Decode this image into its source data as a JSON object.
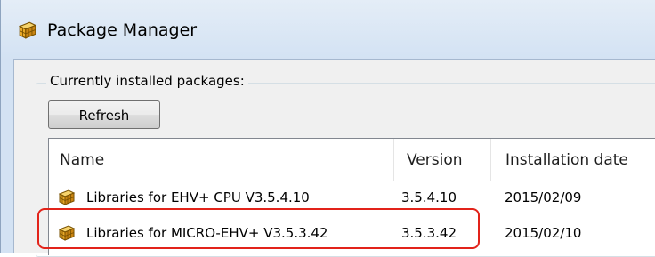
{
  "window": {
    "title": "Package Manager",
    "icon": "package-icon"
  },
  "group": {
    "label": "Currently installed packages:"
  },
  "toolbar": {
    "refresh_label": "Refresh"
  },
  "table": {
    "columns": [
      "Name",
      "Version",
      "Installation date"
    ],
    "rows": [
      {
        "name": "Libraries for EHV+ CPU V3.5.4.10",
        "version": "3.5.4.10",
        "date": "2015/02/09",
        "icon": "package-icon"
      },
      {
        "name": "Libraries for MICRO-EHV+ V3.5.3.42",
        "version": "3.5.3.42",
        "date": "2015/02/10",
        "icon": "package-icon"
      }
    ]
  },
  "annotation": {
    "highlight_color": "#e2231a"
  }
}
